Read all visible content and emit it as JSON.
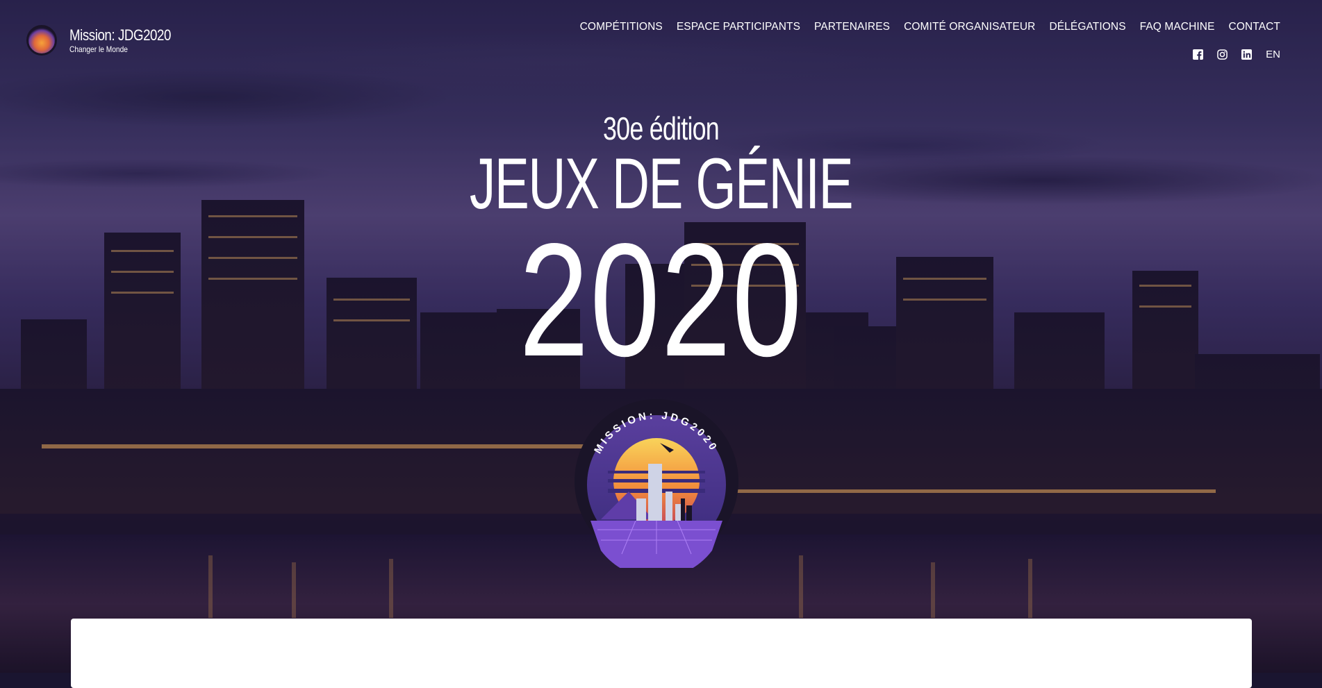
{
  "brand": {
    "title": "Mission: JDG2020",
    "tagline": "Changer le Monde"
  },
  "nav": {
    "items": [
      "COMPÉTITIONS",
      "ESPACE PARTICIPANTS",
      "PARTENAIRES",
      "COMITÉ ORGANISATEUR",
      "DÉLÉGATIONS",
      "FAQ MACHINE",
      "CONTACT"
    ]
  },
  "social": {
    "icons": [
      "facebook-icon",
      "instagram-icon",
      "linkedin-icon"
    ],
    "language": "EN"
  },
  "hero": {
    "edition": "30e édition",
    "title": "JEUX DE GÉNIE",
    "year": "2020",
    "badge_text": "MISSION: JDG2020"
  },
  "colors": {
    "overlay": "#2b2650",
    "badge_sun": "#f6a23a",
    "badge_purple": "#6b3fa0"
  }
}
